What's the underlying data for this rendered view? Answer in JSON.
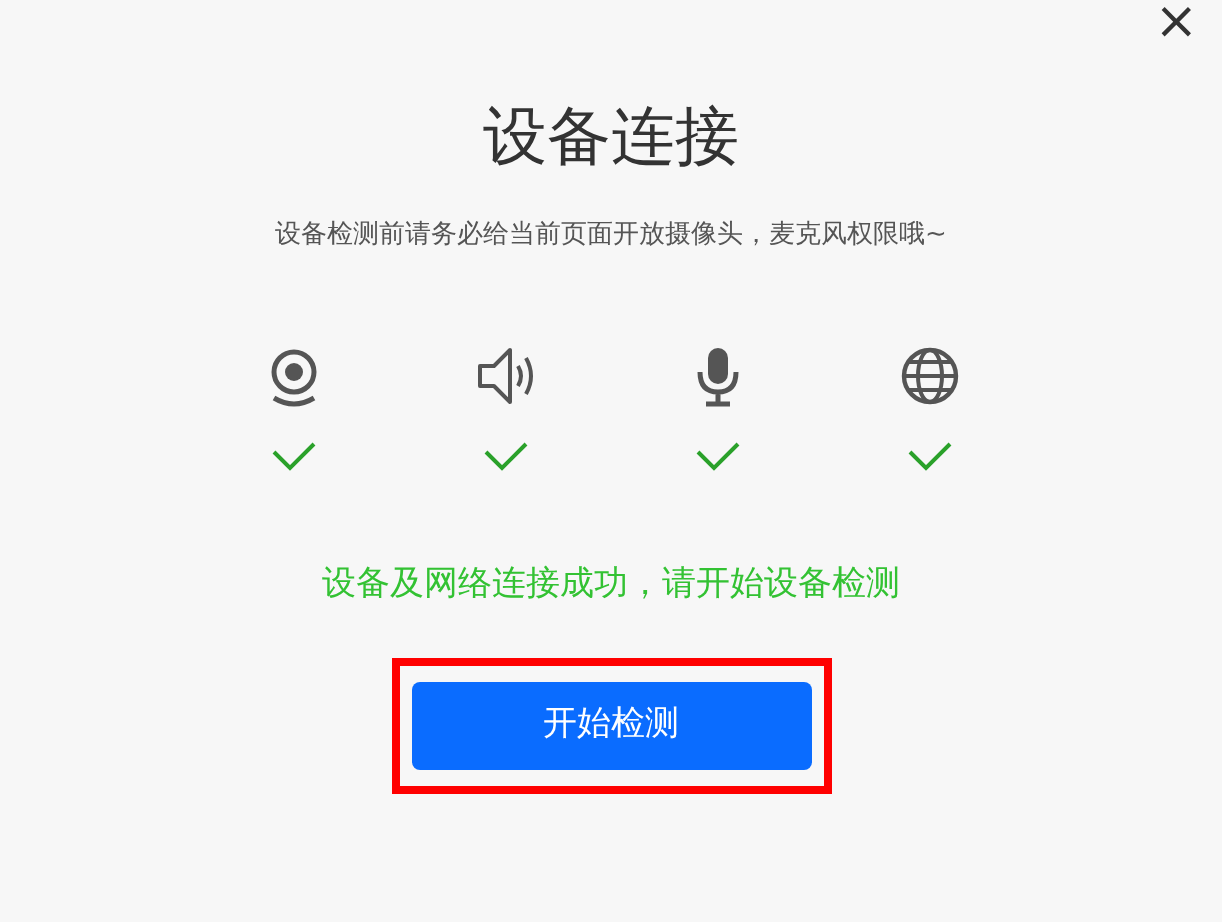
{
  "close": "×",
  "title": "设备连接",
  "subtitle": "设备检测前请务必给当前页面开放摄像头，麦克风权限哦~",
  "devices": [
    {
      "kind": "camera",
      "connected": true
    },
    {
      "kind": "speaker",
      "connected": true
    },
    {
      "kind": "microphone",
      "connected": true
    },
    {
      "kind": "network",
      "connected": true
    }
  ],
  "status": "设备及网络连接成功，请开始设备检测",
  "start_button": {
    "label": "开始检测",
    "highlighted": true
  }
}
